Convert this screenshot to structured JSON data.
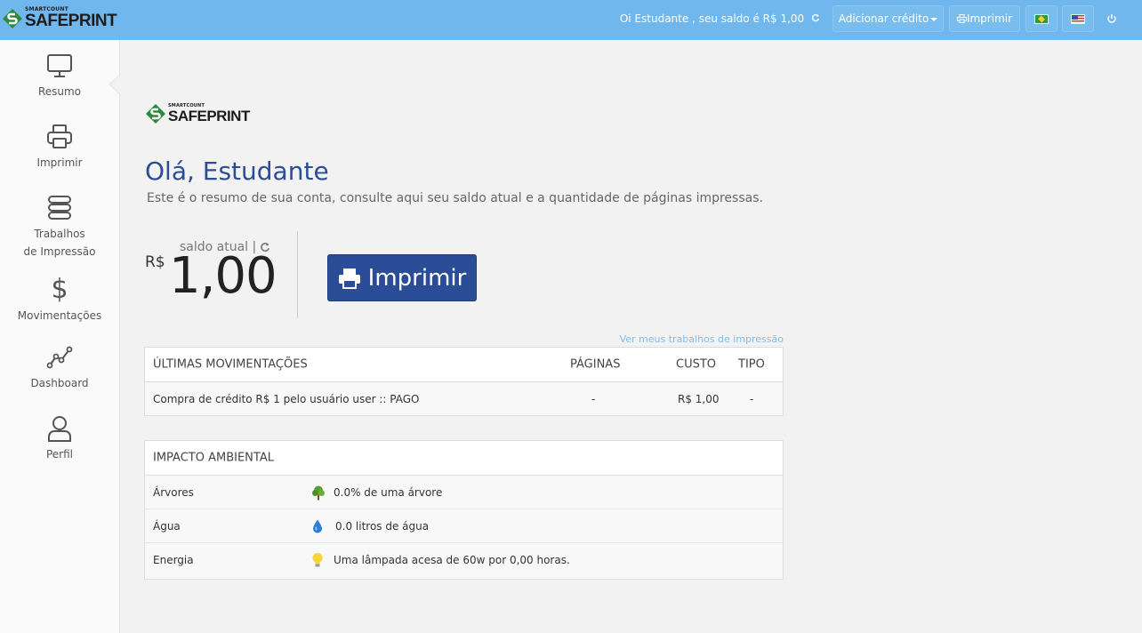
{
  "header": {
    "logo_small": "SMARTCOUNT",
    "logo_big": "SAFEPRINT",
    "greeting": "Oi Estudante , seu saldo é R$ 1,00",
    "add_credit_label": "Adicionar crédito",
    "print_label": "Imprimir",
    "colors": {
      "bar": "#6fb7ec"
    }
  },
  "sidebar": {
    "items": [
      {
        "label": "Resumo",
        "icon": "monitor-icon"
      },
      {
        "label": "Imprimir",
        "icon": "printer-icon"
      },
      {
        "label": "Trabalhos de Impressão",
        "icon": "stack-icon"
      },
      {
        "label": "Movimentações",
        "icon": "dollar-icon"
      },
      {
        "label": "Dashboard",
        "icon": "chart-line-icon"
      },
      {
        "label": "Perfil",
        "icon": "user-icon"
      }
    ],
    "trabalhos_line1": "Trabalhos",
    "trabalhos_line2": "de Impressão"
  },
  "main": {
    "logo_small": "SMARTCOUNT",
    "logo_big": "SAFEPRINT",
    "title": "Olá, Estudante",
    "subtitle": "Este é o resumo de sua conta, consulte aqui seu saldo atual e a quantidade de páginas impressas.",
    "balance": {
      "currency": "R$",
      "label": "saldo atual |",
      "value": "1,00"
    },
    "print_button": "Imprimir",
    "jobs_link": "Ver meus trabalhos de impressão",
    "movements": {
      "headers": [
        "ÚLTIMAS MOVIMENTAÇÕES",
        "PÁGINAS",
        "CUSTO",
        "TIPO"
      ],
      "rows": [
        {
          "description": "Compra de crédito R$ 1 pelo usuário user :: PAGO",
          "pages": "-",
          "cost": "R$ 1,00",
          "type": "-"
        }
      ]
    },
    "environment": {
      "title": "IMPACTO AMBIENTAL",
      "rows": [
        {
          "label": "Árvores",
          "icon": "tree-icon",
          "value": "0.0% de uma árvore"
        },
        {
          "label": "Água",
          "icon": "water-drop-icon",
          "value": "0.0 litros de água"
        },
        {
          "label": "Energia",
          "icon": "lightbulb-icon",
          "value": "Uma lâmpada acesa de 60w por 0,00 horas."
        }
      ]
    },
    "colors": {
      "primary": "#2b4c96",
      "link": "#7fbde9"
    }
  }
}
